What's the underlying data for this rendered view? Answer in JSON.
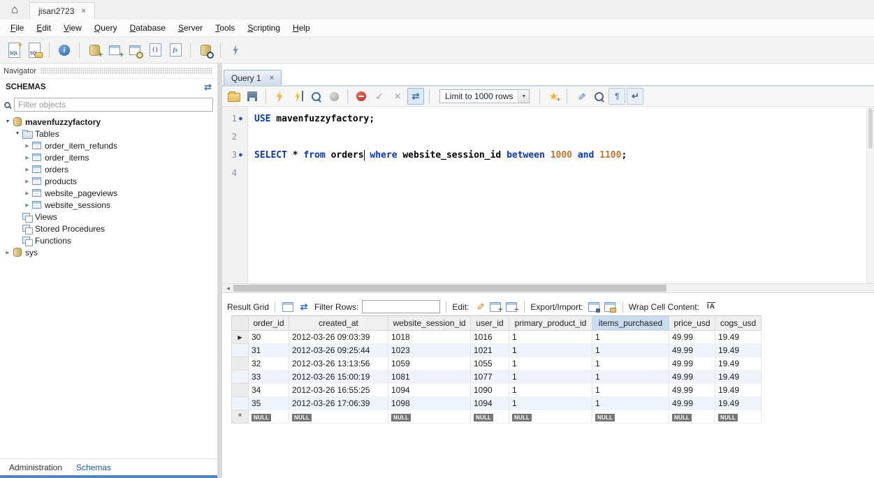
{
  "titlebar": {
    "connection_tab": "jisan2723",
    "close": "×"
  },
  "menu": {
    "items": [
      "File",
      "Edit",
      "View",
      "Query",
      "Database",
      "Server",
      "Tools",
      "Scripting",
      "Help"
    ]
  },
  "main_toolbar": {
    "icons": [
      "new-query-tab",
      "open-sql-script",
      "sep",
      "inspector",
      "sep",
      "create-schema",
      "create-table",
      "create-view",
      "create-procedure",
      "create-function",
      "sep",
      "search-data",
      "sep",
      "reconnect"
    ]
  },
  "navigator": {
    "title": "Navigator",
    "section": "SCHEMAS",
    "filter_placeholder": "Filter objects",
    "tree": [
      {
        "label": "mavenfuzzyfactory",
        "icon": "db",
        "caret": "expanded",
        "bold": true,
        "level": 0
      },
      {
        "label": "Tables",
        "icon": "folder",
        "caret": "expanded",
        "bold": false,
        "level": 1
      },
      {
        "label": "order_item_refunds",
        "icon": "table",
        "caret": "collapsed",
        "bold": false,
        "level": 2
      },
      {
        "label": "order_items",
        "icon": "table",
        "caret": "collapsed",
        "bold": false,
        "level": 2
      },
      {
        "label": "orders",
        "icon": "table",
        "caret": "collapsed",
        "bold": false,
        "level": 2
      },
      {
        "label": "products",
        "icon": "table",
        "caret": "collapsed",
        "bold": false,
        "level": 2
      },
      {
        "label": "website_pageviews",
        "icon": "table",
        "caret": "collapsed",
        "bold": false,
        "level": 2
      },
      {
        "label": "website_sessions",
        "icon": "table",
        "caret": "collapsed",
        "bold": false,
        "level": 2
      },
      {
        "label": "Views",
        "icon": "group",
        "caret": "none",
        "bold": false,
        "level": 1
      },
      {
        "label": "Stored Procedures",
        "icon": "group",
        "caret": "none",
        "bold": false,
        "level": 1
      },
      {
        "label": "Functions",
        "icon": "group",
        "caret": "none",
        "bold": false,
        "level": 1
      },
      {
        "label": "sys",
        "icon": "db",
        "caret": "collapsed",
        "bold": false,
        "level": 0
      }
    ],
    "bottom_tabs": [
      {
        "label": "Administration",
        "active": false
      },
      {
        "label": "Schemas",
        "active": true
      }
    ]
  },
  "editor": {
    "tab": {
      "label": "Query 1",
      "close": "×"
    },
    "toolbar": {
      "icons_left": [
        "open-script",
        "save-script",
        "sep",
        "execute",
        "execute-current",
        "explain",
        "stop",
        "sep",
        "toggle-stop-on-error",
        "commit",
        "rollback",
        "autocommit",
        "sep"
      ],
      "limit_value": "Limit to 1000 rows",
      "icons_right": [
        "sep",
        "save-snippet",
        "sep",
        "beautify",
        "find",
        "invisibles",
        "wrap"
      ]
    },
    "lines": [
      {
        "num": "1",
        "stmt": true,
        "tokens": [
          {
            "t": "kw",
            "v": "USE"
          },
          {
            "t": "pl",
            "v": " mavenfuzzyfactory;"
          }
        ]
      },
      {
        "num": "2",
        "stmt": false,
        "tokens": []
      },
      {
        "num": "3",
        "stmt": true,
        "tokens": [
          {
            "t": "kw",
            "v": "SELECT"
          },
          {
            "t": "pl",
            "v": " * "
          },
          {
            "t": "kw",
            "v": "from"
          },
          {
            "t": "pl",
            "v": " orders"
          },
          {
            "t": "cursor",
            "v": ""
          },
          {
            "t": "pl",
            "v": " "
          },
          {
            "t": "kw",
            "v": "where"
          },
          {
            "t": "pl",
            "v": " website_session_id "
          },
          {
            "t": "kw",
            "v": "between"
          },
          {
            "t": "pl",
            "v": " "
          },
          {
            "t": "num",
            "v": "1000"
          },
          {
            "t": "pl",
            "v": " "
          },
          {
            "t": "kw",
            "v": "and"
          },
          {
            "t": "pl",
            "v": " "
          },
          {
            "t": "num",
            "v": "1100"
          },
          {
            "t": "pl",
            "v": ";"
          }
        ]
      },
      {
        "num": "4",
        "stmt": false,
        "tokens": []
      }
    ]
  },
  "result_grid": {
    "label": "Result Grid",
    "filter_label": "Filter Rows:",
    "filter_value": "",
    "edit_label": "Edit:",
    "export_label": "Export/Import:",
    "wrap_label": "Wrap Cell Content:",
    "wrap_icon_text": "IA",
    "toolbar": {
      "icons_view": [
        "grid-options",
        "refresh"
      ],
      "icons_edit": [
        "edit-record",
        "insert-row",
        "delete-row"
      ],
      "icons_io": [
        "export",
        "import"
      ]
    },
    "columns": [
      "order_id",
      "created_at",
      "website_session_id",
      "user_id",
      "primary_product_id",
      "items_purchased",
      "price_usd",
      "cogs_usd"
    ],
    "selected_column": "items_purchased",
    "rows": [
      [
        "30",
        "2012-03-26 09:03:39",
        "1018",
        "1016",
        "1",
        "1",
        "49.99",
        "19.49"
      ],
      [
        "31",
        "2012-03-26 09:25:44",
        "1023",
        "1021",
        "1",
        "1",
        "49.99",
        "19.49"
      ],
      [
        "32",
        "2012-03-26 13:13:56",
        "1059",
        "1055",
        "1",
        "1",
        "49.99",
        "19.49"
      ],
      [
        "33",
        "2012-03-26 15:00:19",
        "1081",
        "1077",
        "1",
        "1",
        "49.99",
        "19.49"
      ],
      [
        "34",
        "2012-03-26 16:55:25",
        "1094",
        "1090",
        "1",
        "1",
        "49.99",
        "19.49"
      ],
      [
        "35",
        "2012-03-26 17:06:39",
        "1098",
        "1094",
        "1",
        "1",
        "49.99",
        "19.49"
      ]
    ],
    "null_placeholder": "NULL"
  },
  "colors": {
    "keyword": "#0434c8",
    "number_literal": "#c8742a",
    "selected_header": "#c9ddf2",
    "active_tab_accent": "#4a86c8"
  }
}
